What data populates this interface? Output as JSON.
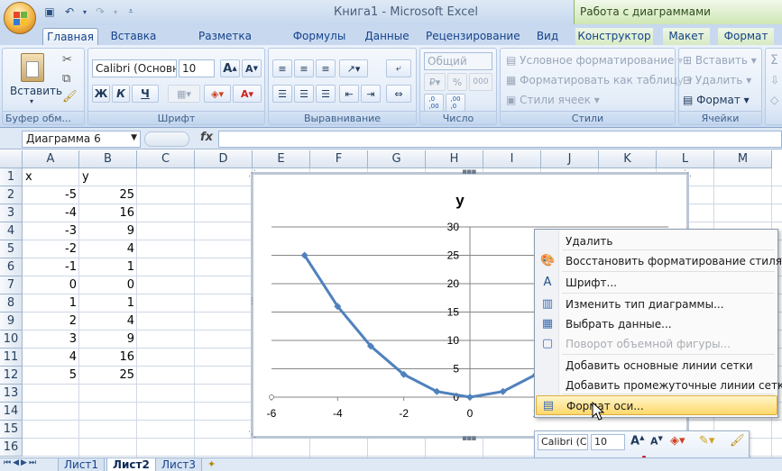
{
  "title_bar": {
    "title": "Книга1 - Microsoft Excel",
    "context_tools": "Работа с диаграммами",
    "qat": [
      "save-icon",
      "undo-icon",
      "redo-icon",
      "customize-icon"
    ]
  },
  "tabs": [
    "Главная",
    "Вставка",
    "Разметка страницы",
    "Формулы",
    "Данные",
    "Рецензирование",
    "Вид",
    "Конструктор",
    "Макет",
    "Формат"
  ],
  "ribbon": {
    "clipboard": {
      "label": "Буфер обм...",
      "paste": "Вставить"
    },
    "font": {
      "label": "Шрифт",
      "font_name": "Calibri (Основн",
      "font_size": "10",
      "bold": "Ж",
      "italic": "К",
      "underline": "Ч"
    },
    "alignment": {
      "label": "Выравнивание"
    },
    "number": {
      "label": "Число",
      "format": "Общий",
      "percent": "%",
      "thousands": "000",
      "dec_inc": ",0\n,00",
      "dec_dec": ",00\n,0"
    },
    "styles": {
      "label": "Стили",
      "conditional": "Условное форматирование",
      "as_table": "Форматировать как таблицу",
      "cell_styles": "Стили ячеек"
    },
    "cells": {
      "label": "Ячейки",
      "insert": "Вставить",
      "delete": "Удалить",
      "format": "Формат"
    },
    "editing": {
      "sigma": "Σ"
    }
  },
  "formula_bar": {
    "name_box": "Диаграмма 6",
    "fx": "fx",
    "value": ""
  },
  "columns": [
    "A",
    "B",
    "C",
    "D",
    "E",
    "F",
    "G",
    "H",
    "I",
    "J",
    "K",
    "L",
    "M"
  ],
  "rows": [
    "1",
    "2",
    "3",
    "4",
    "5",
    "6",
    "7",
    "8",
    "9",
    "10",
    "11",
    "12",
    "13",
    "14",
    "15",
    "16"
  ],
  "cells": {
    "headers": [
      "x",
      "y"
    ],
    "x": [
      "-5",
      "-4",
      "-3",
      "-2",
      "-1",
      "0",
      "1",
      "2",
      "3",
      "4",
      "5"
    ],
    "y": [
      "25",
      "16",
      "9",
      "4",
      "1",
      "0",
      "1",
      "4",
      "9",
      "16",
      "25"
    ]
  },
  "chart_data": {
    "type": "scatter",
    "title": "y",
    "x": [
      -5,
      -4,
      -3,
      -2,
      -1,
      0,
      1,
      2,
      3,
      4,
      5
    ],
    "series": [
      {
        "name": "y",
        "values": [
          25,
          16,
          9,
          4,
          1,
          0,
          1,
          4,
          9,
          16,
          25
        ]
      }
    ],
    "xlim": [
      -6,
      6
    ],
    "ylim": [
      0,
      30
    ],
    "x_ticks": [
      "-6",
      "-4",
      "-2",
      "0",
      "2",
      "4",
      "6"
    ],
    "y_ticks": [
      "0",
      "5",
      "10",
      "15",
      "20",
      "25",
      "30"
    ],
    "grid": true,
    "line_color": "#4f81bd"
  },
  "context_menu": {
    "items": [
      {
        "label": "Удалить",
        "icon": "",
        "enabled": true
      },
      {
        "label": "Восстановить форматирование стиля",
        "icon": "reset-style-icon",
        "enabled": true
      },
      {
        "label": "Шрифт...",
        "icon": "font-icon",
        "enabled": true
      },
      {
        "label": "Изменить тип диаграммы...",
        "icon": "chart-type-icon",
        "enabled": true
      },
      {
        "label": "Выбрать данные...",
        "icon": "select-data-icon",
        "enabled": true
      },
      {
        "label": "Поворот объемной фигуры...",
        "icon": "rotate-3d-icon",
        "enabled": false
      },
      {
        "label": "Добавить основные линии сетки",
        "icon": "",
        "enabled": true
      },
      {
        "label": "Добавить промежуточные линии сетки",
        "icon": "",
        "enabled": true
      },
      {
        "label": "Формат оси...",
        "icon": "format-axis-icon",
        "enabled": true,
        "selected": true
      }
    ]
  },
  "mini_toolbar": {
    "font": "Calibri (С",
    "size": "10",
    "bold": "Ж",
    "italic": "К",
    "font_color": "A"
  },
  "sheet_tabs": [
    "Лист1",
    "Лист2",
    "Лист3"
  ],
  "active_sheet": "Лист2",
  "colors": {
    "accent": "#4f81bd",
    "menu_highlight": "#ffd86b",
    "ribbon": "#dbe7f6"
  }
}
